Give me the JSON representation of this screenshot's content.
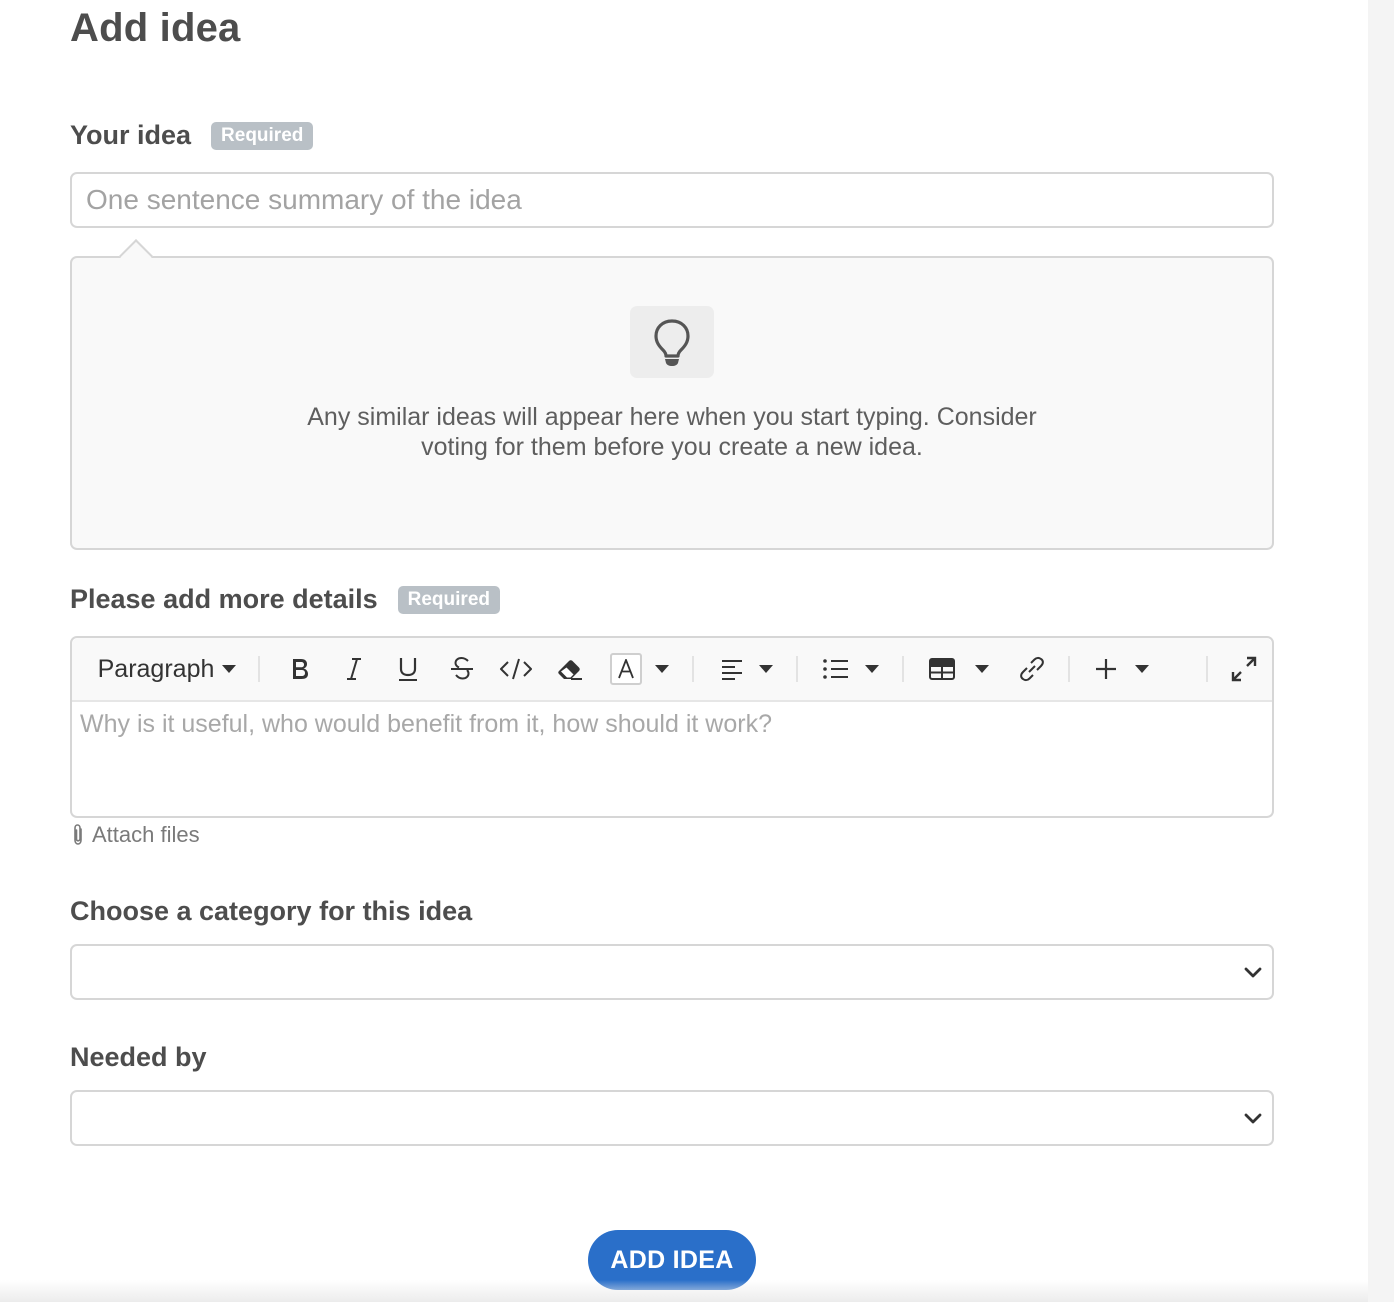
{
  "page": {
    "title": "Add idea"
  },
  "idea_field": {
    "label": "Your idea",
    "required_badge": "Required",
    "placeholder": "One sentence summary of the idea",
    "value": ""
  },
  "similar_ideas": {
    "icon": "lightbulb-icon",
    "message_line1": "Any similar ideas will appear here when you start typing. Consider",
    "message_line2": "voting for them before you create a new idea."
  },
  "details_field": {
    "label": "Please add more details",
    "required_badge": "Required",
    "placeholder": "Why is it useful, who would benefit from it, how should it work?",
    "toolbar": {
      "paragraph_label": "Paragraph",
      "buttons": [
        "bold",
        "italic",
        "underline",
        "strikethrough",
        "code",
        "remove-format",
        "font-color",
        "align",
        "list",
        "table",
        "link",
        "insert",
        "fullscreen"
      ]
    },
    "attach_label": "Attach files"
  },
  "category_field": {
    "label": "Choose a category for this idea",
    "selected": ""
  },
  "needed_by_field": {
    "label": "Needed by",
    "selected": ""
  },
  "submit": {
    "label": "ADD IDEA",
    "color": "#2a6fc9"
  }
}
